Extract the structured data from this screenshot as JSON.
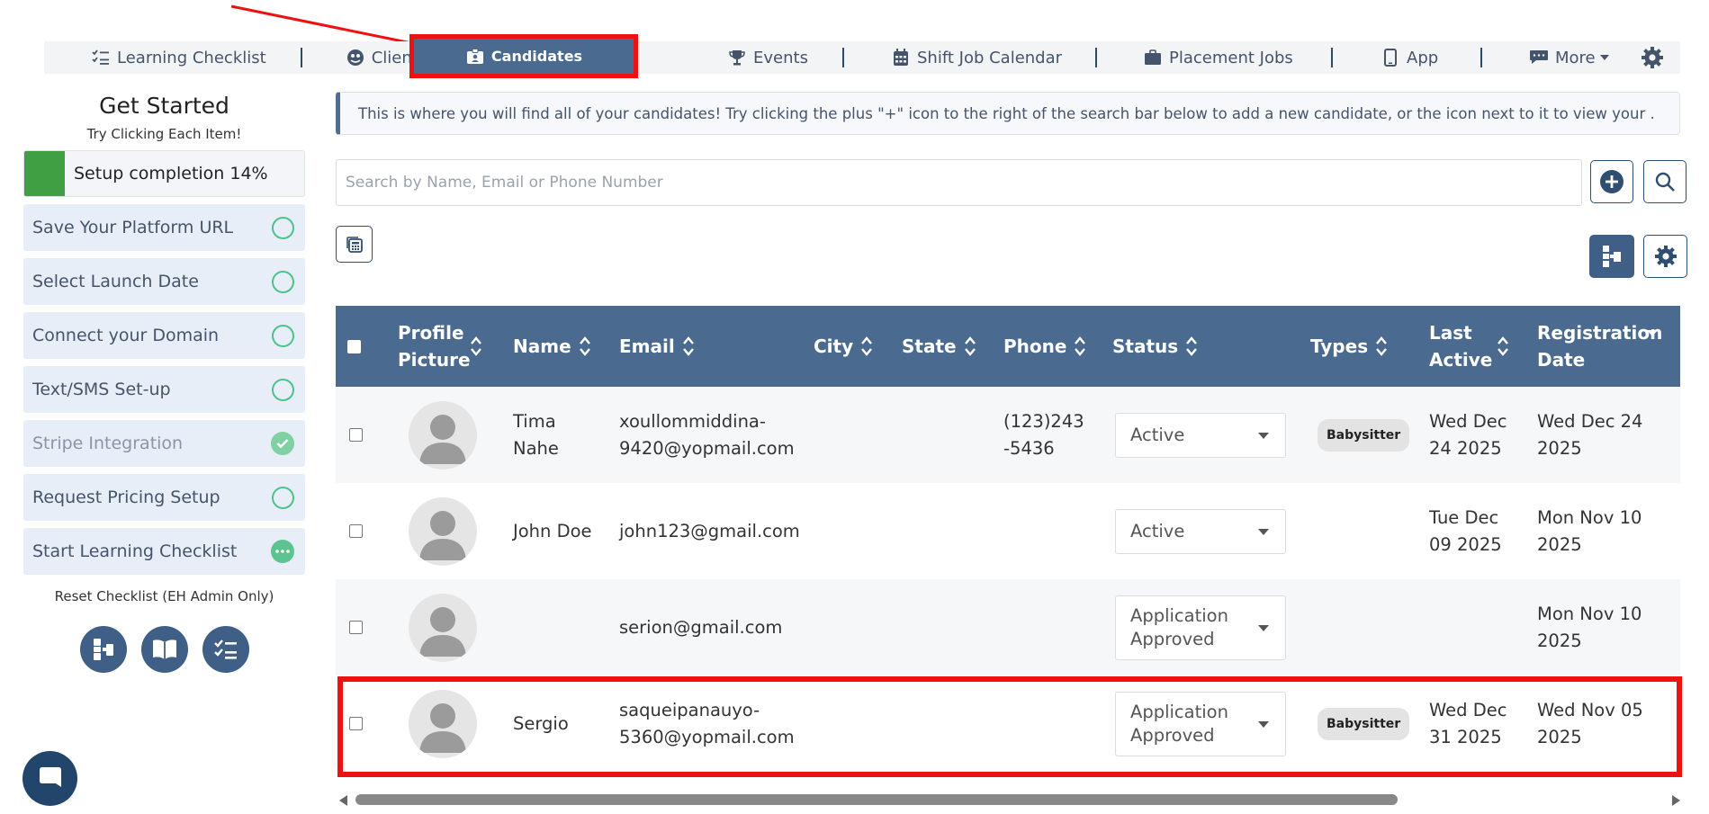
{
  "nav": {
    "learning_checklist": "Learning Checklist",
    "clients": "Clients",
    "candidates": "Candidates",
    "events": "Events",
    "shift_job_calendar": "Shift Job Calendar",
    "placement_jobs": "Placement Jobs",
    "app": "App",
    "more": "More"
  },
  "sidebar": {
    "title": "Get Started",
    "subtitle": "Try Clicking Each Item!",
    "progress_label": "Setup completion 14%",
    "progress_percent": 14,
    "items": [
      {
        "label": "Save Your Platform URL",
        "state": "open"
      },
      {
        "label": "Select Launch Date",
        "state": "open"
      },
      {
        "label": "Connect your Domain",
        "state": "open"
      },
      {
        "label": "Text/SMS Set-up",
        "state": "open"
      },
      {
        "label": "Stripe Integration",
        "state": "done"
      },
      {
        "label": "Request Pricing Setup",
        "state": "open"
      },
      {
        "label": "Start Learning Checklist",
        "state": "in-progress"
      }
    ],
    "reset_label": "Reset Checklist (EH Admin Only)"
  },
  "info_text": "This is where you will find all of your candidates! Try clicking the plus \"+\" icon to the right of the search bar below to add a new candidate, or the icon next to it to view your .",
  "search": {
    "placeholder": "Search by Name, Email or Phone Number",
    "value": ""
  },
  "table": {
    "headers": {
      "profile": "Profile Picture",
      "name": "Name",
      "email": "Email",
      "city": "City",
      "state": "State",
      "phone": "Phone",
      "status": "Status",
      "types": "Types",
      "last_active": "Last Active",
      "registration_date": "Registration Date"
    },
    "rows": [
      {
        "name": "Tima Nahe",
        "email": "xoullommiddina-9420@yopmail.com",
        "city": "",
        "state": "",
        "phone": "(123)243-5436",
        "status": "Active",
        "type": "Babysitter",
        "last_active": "Wed Dec 24 2025",
        "registration_date": "Wed Dec 24 2025"
      },
      {
        "name": "John Doe",
        "email": "john123@gmail.com",
        "city": "",
        "state": "",
        "phone": "",
        "status": "Active",
        "type": "",
        "last_active": "Tue Dec 09 2025",
        "registration_date": "Mon Nov 10 2025"
      },
      {
        "name": "",
        "email": "serion@gmail.com",
        "city": "",
        "state": "",
        "phone": "",
        "status": "Application Approved",
        "type": "",
        "last_active": "",
        "registration_date": "Mon Nov 10 2025"
      },
      {
        "name": "Sergio",
        "email": "saqueipanauyo-5360@yopmail.com",
        "city": "",
        "state": "",
        "phone": "",
        "status": "Application Approved",
        "type": "Babysitter",
        "last_active": "Wed Dec 31 2025",
        "registration_date": "Wed Nov 05 2025"
      }
    ]
  },
  "colors": {
    "accent": "#4a6a8f",
    "highlight": "#ee1111",
    "success": "#3fa043"
  }
}
